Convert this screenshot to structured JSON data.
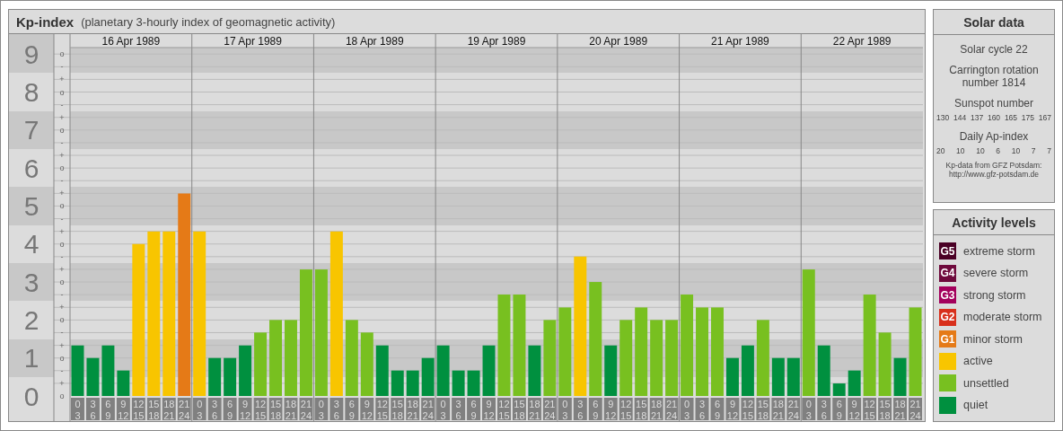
{
  "title": "Kp-index",
  "subtitle": "(planetary 3-hourly index of geomagnetic activity)",
  "chart": {
    "chart_data": {
      "type": "bar",
      "ylim": [
        0,
        9.17
      ],
      "yticks": [
        0,
        1,
        2,
        3,
        4,
        5,
        6,
        7,
        8,
        9
      ],
      "grid": true,
      "categories": [
        "0\n3",
        "3\n6",
        "6\n9",
        "9\n12",
        "12\n15",
        "15\n18",
        "18\n21",
        "21\n24",
        "0\n3",
        "3\n6",
        "6\n9",
        "9\n12",
        "12\n15",
        "15\n18",
        "18\n21",
        "21\n24",
        "0\n3",
        "3\n6",
        "6\n9",
        "9\n12",
        "12\n15",
        "15\n18",
        "18\n21",
        "21\n24",
        "0\n3",
        "3\n6",
        "6\n9",
        "9\n12",
        "12\n15",
        "15\n18",
        "18\n21",
        "21\n24",
        "0\n3",
        "3\n6",
        "6\n9",
        "9\n12",
        "12\n15",
        "15\n18",
        "18\n21",
        "21\n24",
        "0\n3",
        "3\n6",
        "6\n9",
        "9\n12",
        "12\n15",
        "15\n18",
        "18\n21",
        "21\n24",
        "0\n3",
        "3\n6",
        "6\n9",
        "9\n12",
        "12\n15",
        "15\n18",
        "18\n21",
        "21\n24"
      ],
      "series": [
        {
          "color": "#00903f",
          "values": [
            1.33,
            1,
            1.33,
            0.67,
            null,
            null,
            null,
            null,
            null,
            1,
            1,
            1.33,
            null,
            null,
            null,
            null,
            null,
            null,
            null,
            null,
            1.33,
            0.67,
            0.67,
            1,
            1.33,
            0.67,
            0.67,
            1.33,
            null,
            null,
            1.33,
            null,
            null,
            null,
            null,
            1.33,
            null,
            null,
            null,
            null,
            null,
            null,
            null,
            1,
            1.33,
            null,
            1,
            1,
            null,
            1.33,
            0.33,
            0.67,
            null,
            null,
            1,
            null
          ]
        },
        {
          "color": "#78c020",
          "values": [
            null,
            null,
            null,
            null,
            null,
            null,
            null,
            null,
            null,
            null,
            null,
            null,
            1.67,
            2,
            2,
            3.33,
            3.33,
            null,
            2,
            1.67,
            null,
            null,
            null,
            null,
            null,
            null,
            null,
            null,
            2.67,
            2.67,
            null,
            2,
            2.33,
            null,
            3,
            null,
            2,
            2.33,
            2,
            2,
            2.67,
            2.33,
            2.33,
            null,
            null,
            2,
            null,
            null,
            3.33,
            null,
            null,
            null,
            2.67,
            1.67,
            null,
            2.33
          ]
        },
        {
          "color": "#f8c500",
          "values": [
            null,
            null,
            null,
            null,
            4,
            4.33,
            4.33,
            null,
            4.33,
            null,
            null,
            null,
            null,
            null,
            null,
            null,
            null,
            4.33,
            null,
            null,
            null,
            null,
            null,
            null,
            null,
            null,
            null,
            null,
            null,
            null,
            null,
            null,
            null,
            3.67,
            null,
            null,
            null,
            null,
            null,
            null,
            null,
            null,
            null,
            null,
            null,
            null,
            null,
            null,
            null,
            null,
            null,
            null,
            null,
            null,
            null,
            null
          ]
        },
        {
          "color": "#e57a17",
          "values": [
            null,
            null,
            null,
            null,
            null,
            null,
            null,
            5.33,
            null,
            null,
            null,
            null,
            null,
            null,
            null,
            null,
            null,
            null,
            null,
            null,
            null,
            null,
            null,
            null,
            null,
            null,
            null,
            null,
            null,
            null,
            null,
            null,
            null,
            null,
            null,
            null,
            null,
            null,
            null,
            null,
            null,
            null,
            null,
            null,
            null,
            null,
            null,
            null,
            null,
            null,
            null,
            null,
            null,
            null,
            null,
            null
          ]
        }
      ]
    },
    "minor_axis_labels": [
      "o",
      "-",
      "+",
      "o",
      "-",
      "+",
      "o",
      "-",
      "+",
      "o",
      "-",
      "+",
      "o",
      "-",
      "+",
      "o",
      "-",
      "+",
      "o",
      "-",
      "+",
      "o",
      "-",
      "+",
      "o",
      "-",
      "+",
      "o"
    ],
    "dates": [
      "16 Apr 1989",
      "17 Apr 1989",
      "18 Apr 1989",
      "19 Apr 1989",
      "20 Apr 1989",
      "21 Apr 1989",
      "22 Apr 1989"
    ]
  },
  "solar_data": {
    "title": "Solar data",
    "solar_cycle": "Solar cycle 22",
    "carrington": "Carrington rotation number 1814",
    "sunspot_label": "Sunspot number",
    "sunspot_numbers": [
      "130",
      "144",
      "137",
      "160",
      "165",
      "175",
      "167"
    ],
    "ap_label": "Daily Ap-index",
    "ap_values": [
      "20",
      "10",
      "10",
      "6",
      "10",
      "7",
      "7"
    ],
    "source_note": "Kp-data from GFZ Potsdam:",
    "source_url": "http://www.gfz-potsdam.de"
  },
  "activity_levels": {
    "title": "Activity levels",
    "items": [
      {
        "badge": "G5",
        "label": "extreme storm",
        "color": "#4a0025"
      },
      {
        "badge": "G4",
        "label": "severe storm",
        "color": "#6e0a3c"
      },
      {
        "badge": "G3",
        "label": "strong storm",
        "color": "#a3005c"
      },
      {
        "badge": "G2",
        "label": "moderate storm",
        "color": "#d8301c"
      },
      {
        "badge": "G1",
        "label": "minor storm",
        "color": "#e57a17"
      },
      {
        "label": "active",
        "color": "#f8c500"
      },
      {
        "label": "unsettled",
        "color": "#78c020"
      },
      {
        "label": "quiet",
        "color": "#00903f"
      }
    ]
  }
}
